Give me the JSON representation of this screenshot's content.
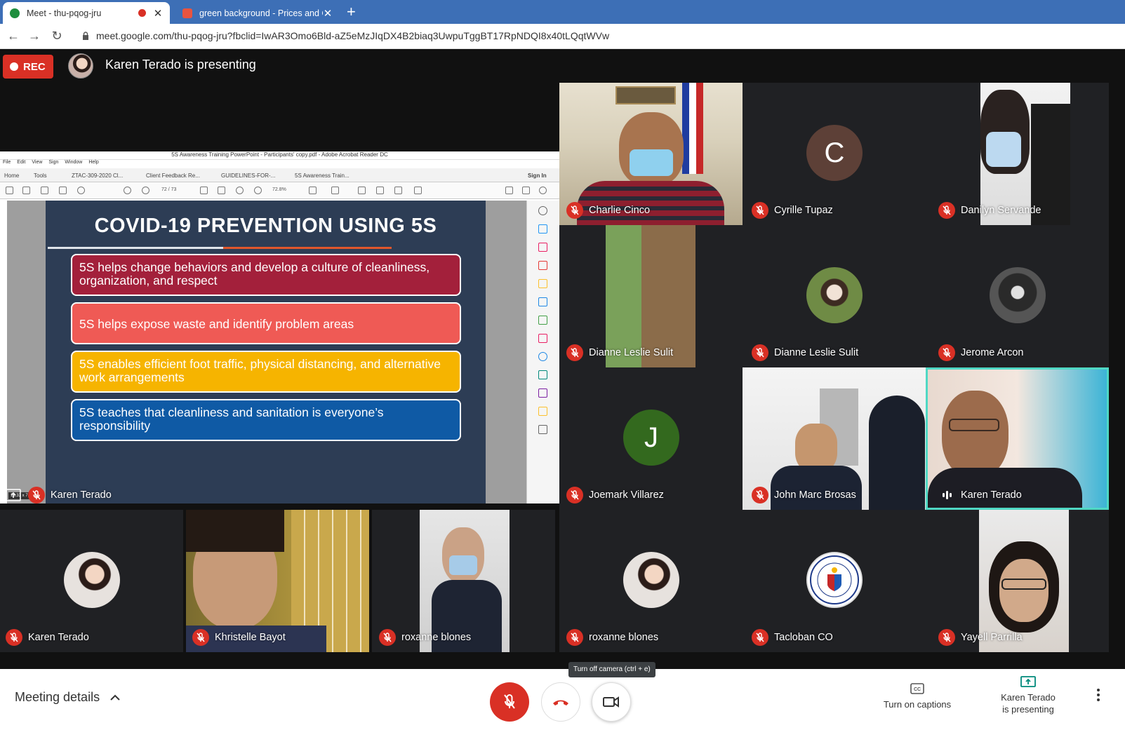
{
  "browser": {
    "tabs": [
      {
        "title": "Meet - thu-pqog-jru",
        "recording": true
      },
      {
        "title": "green background - Prices and C"
      }
    ],
    "url": "meet.google.com/thu-pqog-jru?fbclid=IwAR3Omo6Bld-aZ5eMzJIqDX4B2biaq3UwpuTggBT17RpNDQI8x40tLQqtWVw"
  },
  "meet": {
    "rec_label": "REC",
    "presenting_banner": "Karen Terado is presenting",
    "presentation_owner": "Karen Terado"
  },
  "acrobat": {
    "window_title": "5S Awareness Training PowerPoint - Participants' copy.pdf - Adobe Acrobat Reader DC",
    "menu": [
      "File",
      "Edit",
      "View",
      "Sign",
      "Window",
      "Help"
    ],
    "tabs": [
      "Home",
      "Tools",
      "ZTAC-309-2020 Cl...",
      "Client Feedback Re...",
      "GUIDELINES-FOR-...",
      "5S Awareness Train..."
    ],
    "sign_in": "Sign In",
    "page_indicator": "72 / 73",
    "zoom": "72.8%",
    "page_size": "13.33 x 7.50 in"
  },
  "slide": {
    "title": "COVID-19 PREVENTION USING 5S",
    "items": [
      {
        "text": "5S helps change behaviors and develop a culture of cleanliness, organization, and respect",
        "color": "#a3203b"
      },
      {
        "text": "5S helps expose waste and identify problem areas",
        "color": "#ef5a55"
      },
      {
        "text": "5S enables efficient foot traffic, physical distancing, and alternative work arrangements",
        "color": "#f6b400"
      },
      {
        "text": "5S teaches that cleanliness and sanitation is everyone’s responsibility",
        "color": "#0f5aa5"
      }
    ]
  },
  "participants": [
    {
      "name": "Charlie Cinco"
    },
    {
      "name": "Cyrille Tupaz",
      "initial": "C",
      "avatar_color": "#5d4037"
    },
    {
      "name": "Danilyn Servande"
    },
    {
      "name": "Dianne Leslie Sulit"
    },
    {
      "name": "Dianne Leslie Sulit"
    },
    {
      "name": "Jerome Arcon"
    },
    {
      "name": "Joemark Villarez",
      "initial": "J",
      "avatar_color": "#33691e"
    },
    {
      "name": "John Marc Brosas"
    },
    {
      "name": "Karen Terado",
      "speaking": true
    },
    {
      "name": "Karen Terado"
    },
    {
      "name": "Khristelle Bayot"
    },
    {
      "name": "roxanne blones"
    },
    {
      "name": "roxanne blones"
    },
    {
      "name": "Tacloban CO"
    },
    {
      "name": "Yayell Parrilla"
    }
  ],
  "controls": {
    "meeting_details": "Meeting details",
    "tooltip": "Turn off camera (ctrl + e)",
    "captions": "Turn on captions",
    "presenting_line1": "Karen Terado",
    "presenting_line2": "is presenting"
  },
  "colors": {
    "accent_red": "#d93025",
    "speaker_border": "#4fd8c4",
    "chrome_blue": "#3d6fb6"
  }
}
